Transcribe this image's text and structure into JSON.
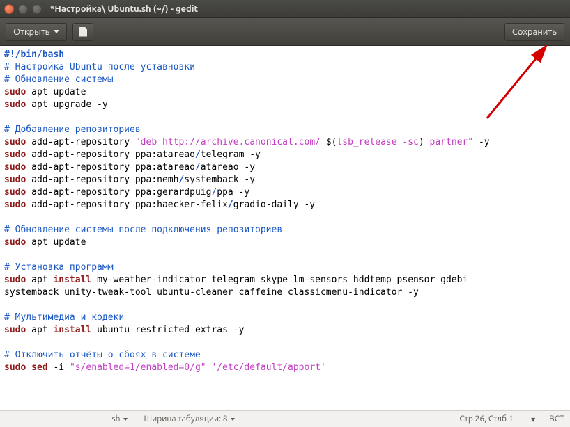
{
  "window": {
    "title": "*Настройка\\ Ubuntu.sh (~/) - gedit"
  },
  "toolbar": {
    "open_label": "Открыть",
    "save_label": "Сохранить"
  },
  "code": {
    "l1": "#!/bin/bash",
    "l2": "# Настройка Ubuntu после уставновки",
    "l3": "# Обновление системы",
    "l4a": "sudo",
    "l4b": " apt update",
    "l5a": "sudo",
    "l5b": " apt upgrade -y",
    "l6": "",
    "l7": "# Добавление репозиториев",
    "l8a": "sudo",
    "l8b": " add-apt-repository ",
    "l8c": "\"deb http://archive.canonical.com/ ",
    "l8d": "$(",
    "l8e": "lsb_release -sc",
    "l8f": ")",
    "l8g": " partner\"",
    "l8h": " -y",
    "l9a": "sudo",
    "l9b": " add-apt-repository ppa:atareao",
    "l9s": "/",
    "l9c": "telegram -y",
    "l10a": "sudo",
    "l10b": " add-apt-repository ppa:atareao",
    "l10s": "/",
    "l10c": "atareao -y",
    "l11a": "sudo",
    "l11b": " add-apt-repository ppa:nemh",
    "l11s": "/",
    "l11c": "systemback -y",
    "l12a": "sudo",
    "l12b": " add-apt-repository ppa:gerardpuig",
    "l12s": "/",
    "l12c": "ppa -y",
    "l13a": "sudo",
    "l13b": " add-apt-repository ppa:haecker-felix",
    "l13s": "/",
    "l13c": "gradio-daily -y",
    "l14": "",
    "l15": "# Обновление системы после подключения репозиториев",
    "l16a": "sudo",
    "l16b": " apt update",
    "l17": "",
    "l18": "# Установка программ",
    "l19a": "sudo",
    "l19b": " apt ",
    "l19c": "install",
    "l19d": " my-weather-indicator telegram skype lm-sensors hddtemp psensor gdebi",
    "l20": "systemback unity-tweak-tool ubuntu-cleaner caffeine classicmenu-indicator -y",
    "l21": "",
    "l22": "# Мультимедиа и кодеки",
    "l23a": "sudo",
    "l23b": " apt ",
    "l23c": "install",
    "l23d": " ubuntu-restricted-extras -y",
    "l24": "",
    "l25": "# Отключить отчёты о сбоях в системе",
    "l26a": "sudo",
    "l26b": " ",
    "l26c": "sed",
    "l26d": " -i ",
    "l26e": "\"s/enabled=1/enabled=0/g\"",
    "l26f": " ",
    "l26g": "'/etc/default/apport'"
  },
  "status": {
    "syntax": "sh",
    "tab_label": "Ширина табуляции: 8",
    "cursor": "Стр 26, Стлб 1",
    "ins": "ВСТ"
  }
}
